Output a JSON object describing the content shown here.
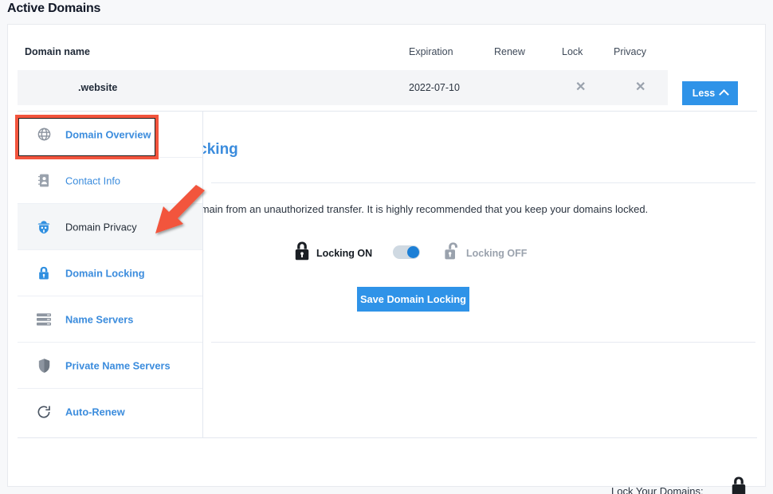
{
  "page": {
    "title": "Active Domains",
    "accent_blue": "#2f93e8",
    "link_blue": "#3b8cdd",
    "annotation_red": "#f2543d",
    "background": "#f7f8fa"
  },
  "table": {
    "headers": {
      "domain_name": "Domain name",
      "expiration": "Expiration",
      "renew": "Renew",
      "lock": "Lock",
      "privacy": "Privacy"
    },
    "row": {
      "domain_name": ".website",
      "expiration": "2022-07-10",
      "lock_icon": "close-x-icon",
      "privacy_icon": "close-x-icon",
      "toggle_label": "Less",
      "toggle_chevron": "chevron-up-icon"
    }
  },
  "sidebar": {
    "items": [
      {
        "label": "Domain Overview",
        "icon": "globe-icon",
        "state": "highlighted"
      },
      {
        "label": "Contact Info",
        "icon": "contact-card-icon",
        "state": "default"
      },
      {
        "label": "Domain Privacy",
        "icon": "privacy-detective-icon",
        "state": "active"
      },
      {
        "label": "Domain Locking",
        "icon": "padlock-icon",
        "state": "selected"
      },
      {
        "label": "Name Servers",
        "icon": "server-stack-icon",
        "state": "default"
      },
      {
        "label": "Private Name Servers",
        "icon": "shield-icon",
        "state": "default"
      },
      {
        "label": "Auto-Renew",
        "icon": "refresh-circular-icon",
        "state": "default"
      }
    ]
  },
  "content": {
    "title": "Domain Locking",
    "description": "Domain Locking is a security feature designed to protect your domain from an unauthorized transfer. It is highly recommended that you keep your domains locked.",
    "locking_on_label": "Locking ON",
    "locking_off_label": "Locking OFF",
    "locking_on_icon": "closed-padlock-icon",
    "locking_off_icon": "open-padlock-icon",
    "toggle_state": "on",
    "save_label": "Save Domain Locking"
  },
  "footer": {
    "note": "Lock Your Domains:",
    "icon": "closed-padlock-icon"
  },
  "annotations": {
    "highlight_target": "Domain Overview",
    "arrow_target": "Domain Privacy"
  }
}
